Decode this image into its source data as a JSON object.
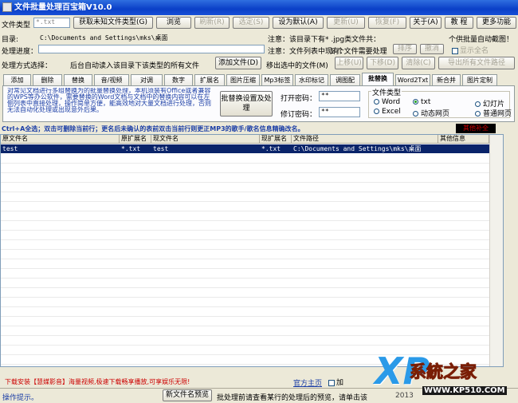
{
  "window": {
    "title": "文件批量处理百宝箱V10.0"
  },
  "toolbar": {
    "file_type_label": "文件类型",
    "file_type_value": "*.txt",
    "get_unknown_button": "获取未知文件类型(G)",
    "browse_button": "浏览",
    "refresh_button": "刷新(R)",
    "selected_button": "选定(S)",
    "set_default_button": "设为默认(A)",
    "update_button": "更新(U)",
    "recover_button": "恢复(F)",
    "about_button": "关于(A)",
    "tutorial_button": "教 程",
    "more_button": "更多功能"
  },
  "row2": {
    "dir_label": "目录:",
    "dir_value": "C:\\Documents and Settings\\mks\\桌面",
    "notice1": "注意：该目录下有* .jpg类文件共：",
    "notice1_right": "个供批量自动截图！",
    "notice2": "注意：文件列表中现有：",
    "notice2_mid": "1 个文件需要处理",
    "progress_label": "处理进度：",
    "sort_up_button": "上移(U)",
    "sort_down_button": "下移(D)",
    "auto_sort_button": "自动排序",
    "undo_button": "撤消",
    "sort_label": "排序",
    "checkbox_label": "显示全名"
  },
  "row3": {
    "method_label": "处理方式选择：",
    "auto_read_text": "后台自动读入该目录下该类型的所有文件",
    "add_file_button": "添加文件(D)",
    "remove_selected_button": "移出选中的文件(M)",
    "move_up_button": "上移(U)",
    "move_down_button": "下移(D)",
    "clear_button": "清除(C)",
    "export_button": "导出所有文件路径"
  },
  "tabs": [
    "添加",
    "删除",
    "替换",
    "音/视频",
    "对调",
    "数字",
    "扩展名",
    "图片压缩",
    "Mp3标签",
    "水印标记",
    "调图配",
    "批替换",
    "Word2Txt",
    "新合并",
    "图片定制"
  ],
  "active_tab": "批替换",
  "panel": {
    "description": "对常见文档进行多组替换为的批量替换处理，本机须装有Office或者兼容的WPS等办公软件，需要替换的Word文档与文档中的替换内容可以在左侧列表中直接处理，操作简单方便，能高效地对大量文档进行处理，否则无法自动化处理或出现意外后果。",
    "batch_settings_button": "批替换设置及处 理",
    "open_password_label": "打开密码：",
    "open_password_value": "**",
    "modify_password_label": "修订密码：",
    "modify_password_value": "**",
    "file_type_group": "文件类型",
    "options": [
      {
        "label": "Word",
        "on": false
      },
      {
        "label": "txt",
        "on": true
      },
      {
        "label": "幻灯片",
        "on": false
      },
      {
        "label": "Excel",
        "on": false
      },
      {
        "label": "动态网页",
        "on": false
      },
      {
        "label": "普通网页",
        "on": false
      }
    ]
  },
  "hint": {
    "text": "Ctrl+A全选；双击可删除当前行；更名后未确认的表前双击当前行则更正MP3的歌手/歌名信息精确改名。",
    "badge": "其他补全"
  },
  "table": {
    "columns": [
      "原文件名",
      "原扩展名",
      "现文件名",
      "现扩展名",
      "文件路径",
      "其他信息"
    ],
    "rows": [
      [
        "test",
        "*.txt",
        "test",
        "*.txt",
        "C:\\Documents and Settings\\mks\\桌面",
        ""
      ]
    ]
  },
  "bottom": {
    "promo_text": "下载安装【慧媒影音】海量视频,极速下载畅享播放,可享娱乐无限!",
    "official_link": "官方主页",
    "add_checkbox": "加"
  },
  "status": {
    "main": "操作提示。",
    "preview_button": "新文件名预览",
    "preview_text": "批处理前请查看某行的处理后的预览，请单击该",
    "year": "2013"
  },
  "watermark": {
    "brand": "系統之家",
    "url": "WWW.KP510.COM"
  }
}
